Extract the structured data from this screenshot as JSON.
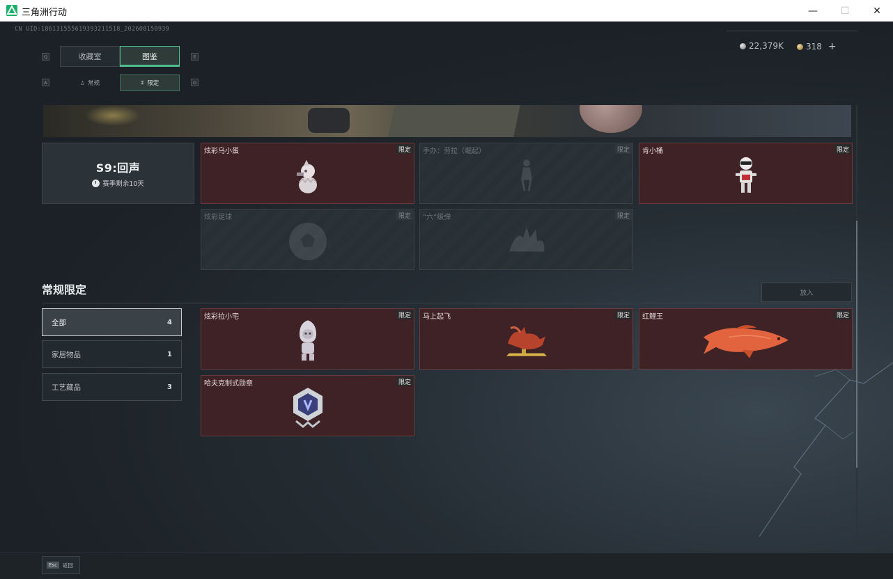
{
  "window": {
    "title": "三角洲行动",
    "icon": "delta-force-logo-icon",
    "controls": {
      "minimize": "—",
      "maximize": "☐",
      "close": "✕"
    }
  },
  "header": {
    "uid": "CN UID:18613155561939321151​8_202608150939",
    "currency_1": {
      "icon": "silver-coin-icon",
      "value": "22,379K"
    },
    "currency_2": {
      "icon": "gold-coin-icon",
      "value": "318",
      "add": "+"
    }
  },
  "tabs_primary": {
    "key_left": "Q",
    "key_right": "E",
    "items": [
      {
        "label": "收藏室",
        "active": false
      },
      {
        "label": "图鉴",
        "active": true
      }
    ]
  },
  "tabs_secondary": {
    "key_left": "A",
    "key_right": "D",
    "items": [
      {
        "label": "常规",
        "icon": "figure-icon",
        "active": false
      },
      {
        "label": "限定",
        "icon": "hourglass-icon",
        "active": true
      }
    ]
  },
  "season": {
    "name": "S9:回声",
    "remaining": "赛季剩余10天"
  },
  "season_cards": [
    {
      "name": "炫彩乌小蛋",
      "tag": "限定",
      "owned": true,
      "icon": "egg-creature-icon"
    },
    {
      "name": "手办：劳拉（崛起）",
      "tag": "限定",
      "owned": false,
      "icon": "figurine-icon"
    },
    {
      "name": "肯小桶",
      "tag": "限定",
      "owned": true,
      "icon": "bucket-figure-icon"
    },
    {
      "name": "炫彩足球",
      "tag": "限定",
      "owned": false,
      "icon": "football-icon"
    },
    {
      "name": "“六”级弹",
      "tag": "限定",
      "owned": false,
      "icon": "hand-gesture-icon"
    }
  ],
  "section": {
    "title": "常规限定",
    "place_button": "放入"
  },
  "filters": [
    {
      "label": "全部",
      "count": "4",
      "active": true
    },
    {
      "label": "家居物品",
      "count": "1",
      "active": false
    },
    {
      "label": "工艺藏品",
      "count": "3",
      "active": false
    }
  ],
  "regular_cards": [
    {
      "name": "炫彩拉小宅",
      "tag": "限定",
      "owned": true,
      "icon": "astronaut-figure-icon"
    },
    {
      "name": "马上起飞",
      "tag": "限定",
      "owned": true,
      "icon": "flying-horse-icon"
    },
    {
      "name": "红鲤王",
      "tag": "限定",
      "owned": true,
      "icon": "red-carp-icon"
    },
    {
      "name": "哈夫克制式勋章",
      "tag": "限定",
      "owned": true,
      "icon": "medal-icon"
    }
  ],
  "footer": {
    "key": "Esc",
    "label": "返回"
  }
}
